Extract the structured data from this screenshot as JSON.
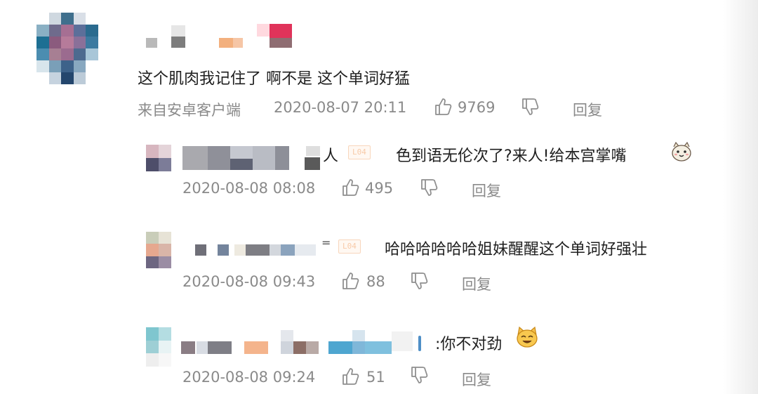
{
  "comment": {
    "text": "这个肌肉我记住了 啊不是 这个单词好猛",
    "source": "来自安卓客户端",
    "time": "2020-08-07 20:11",
    "likes": "9769",
    "reply_label": "回复"
  },
  "replies": [
    {
      "name_suffix": "人",
      "badge": "L04",
      "text": "色到语无伦次了?来人!给本宫掌嘴",
      "emoji_icon": "cute-face-emoji-icon",
      "time": "2020-08-08 08:08",
      "likes": "495",
      "reply_label": "回复"
    },
    {
      "name_suffix": "=",
      "badge": "L04",
      "text": "哈哈哈哈哈哈姐妹醒醒这个单词好强壮",
      "time": "2020-08-08 09:43",
      "likes": "88",
      "reply_label": "回复"
    },
    {
      "text": ":你不对劲",
      "emoji_icon": "cat-face-emoji-icon",
      "time": "2020-08-08 09:24",
      "likes": "51",
      "reply_label": "回复"
    }
  ],
  "icons": {
    "like": "thumbs-up-icon",
    "dislike": "thumbs-down-icon"
  }
}
